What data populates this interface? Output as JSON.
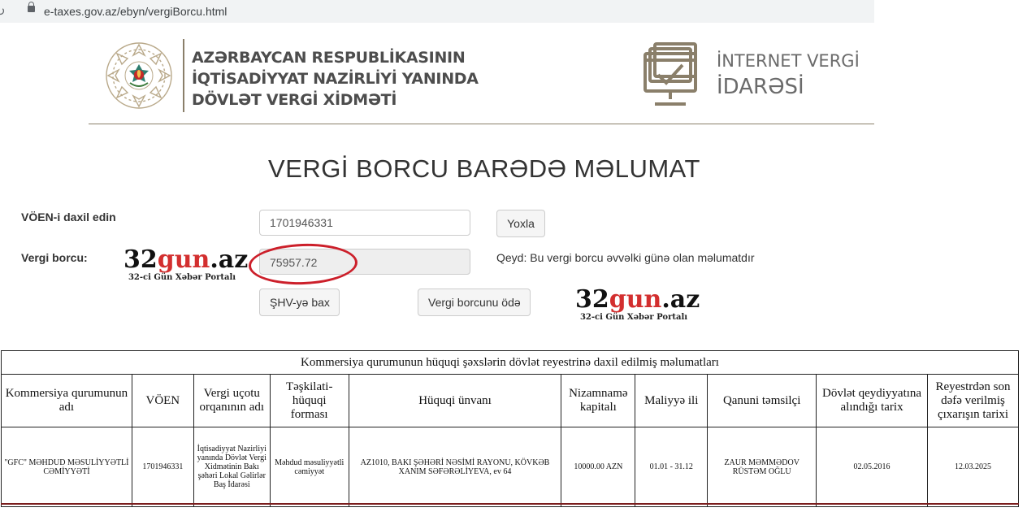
{
  "browser": {
    "url": "e-taxes.gov.az/ebyn/vergiBorcu.html"
  },
  "header": {
    "org_line1": "AZƏRBAYCAN RESPUBLİKASININ",
    "org_line2": "İQTİSADİYYAT NAZİRLİYİ YANINDA",
    "org_line3": "DÖVLƏT VERGİ XİDMƏTİ",
    "portal_line1": "İNTERNET VERGİ",
    "portal_line2": "İDARƏSİ"
  },
  "page": {
    "title": "VERGİ BORCU BARƏDƏ MƏLUMAT"
  },
  "form": {
    "voen_label": "VÖEN-i daxil edin",
    "voen_value": "1701946331",
    "check_button": "Yoxla",
    "debt_label": "Vergi borcu:",
    "debt_value": "75957.72",
    "note": "Qeyd: Bu vergi borcu əvvəlki günə olan məlumatdır",
    "shv_button": "ŞHV-yə bax",
    "pay_button": "Vergi borcunu ödə"
  },
  "watermark": {
    "brand_dark_1": "32",
    "brand_red": "gun",
    "brand_dark_2": ".az",
    "tagline": "32-ci Gün Xəbər Portalı"
  },
  "registry_table": {
    "caption": "Kommersiya qurumunun hüquqi şəxslərin dövlət reyestrinə daxil edilmiş məlumatları",
    "columns": [
      "Kommersiya qurumunun adı",
      "VÖEN",
      "Vergi uçotu orqanının adı",
      "Təşkilati-hüquqi forması",
      "Hüquqi ünvanı",
      "Nizamnamə kapitalı",
      "Maliyyə ili",
      "Qanuni təmsilçi",
      "Dövlət qeydiyyatına alındığı tarix",
      "Reyestrdən son dəfə verilmiş çıxarışın tarixi"
    ],
    "rows": [
      [
        "\"GFC\" MƏHDUD MƏSULİYYƏTLİ CƏMİYYƏTİ",
        "1701946331",
        "İqtisadiyyat Nazirliyi yanında Dövlət Vergi Xidmətinin Bakı şəhəri Lokal Gəlirlər Baş İdarəsi",
        "Məhdud məsuliyyətli cəmiyyət",
        "AZ1010, BAKI ŞƏHƏRİ NƏSİMİ RAYONU, KÖVKƏB XANIM SƏFƏRƏLİYEVA, ev 64",
        "10000.00 AZN",
        "01.01 - 31.12",
        "ZAUR MƏMMƏDOV RÜSTƏM OĞLU",
        "02.05.2016",
        "12.03.2025"
      ]
    ]
  },
  "colors": {
    "accent_olive": "#8a7f6a",
    "highlight_red": "#cc1f2a",
    "brand_red": "#d32f2f"
  }
}
